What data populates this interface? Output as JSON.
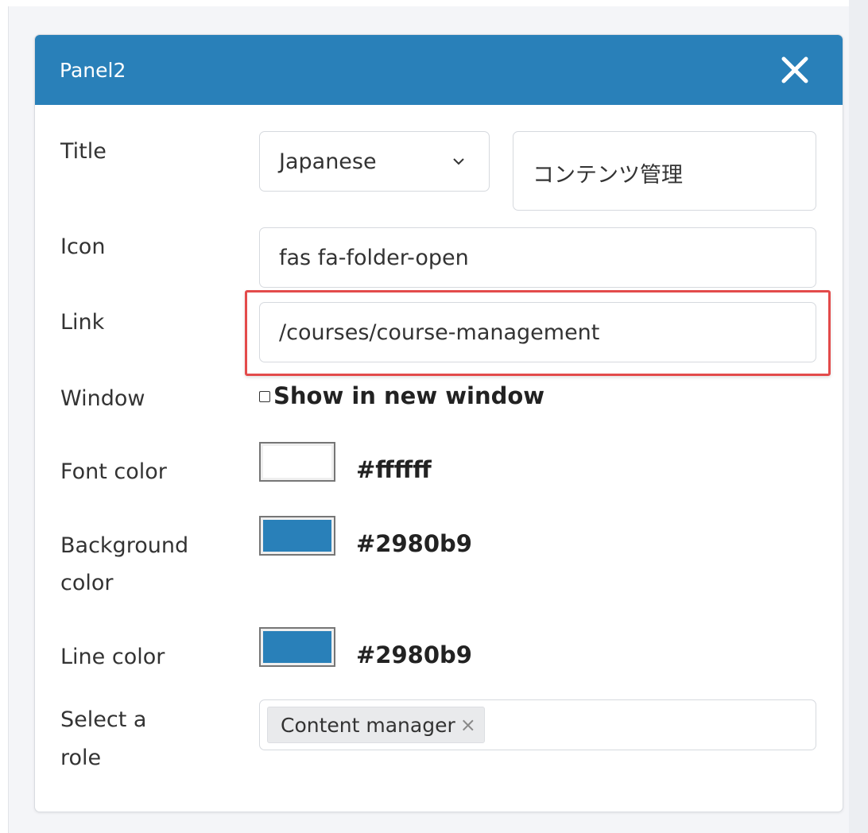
{
  "panel": {
    "title": "Panel2",
    "header_color": "#2980b9",
    "close_icon": "close-icon"
  },
  "form": {
    "title_label": "Title",
    "language_value": "Japanese",
    "title_value": "コンテンツ管理",
    "icon_label": "Icon",
    "icon_value": "fas fa-folder-open",
    "link_label": "Link",
    "link_value": "/courses/course-management",
    "window_label": "Window",
    "window_checkbox_label": "Show in new window",
    "window_checked": false,
    "font_color_label": "Font color",
    "font_color_value": "#ffffff",
    "background_color_label_line1": "Background",
    "background_color_label_line2": "color",
    "background_color_value": "#2980b9",
    "line_color_label": "Line color",
    "line_color_value": "#2980b9",
    "role_label_line1": "Select a",
    "role_label_line2": "role",
    "role_tag": "Content manager",
    "role_tag_remove": "×"
  },
  "highlight_color": "#e34b4b"
}
